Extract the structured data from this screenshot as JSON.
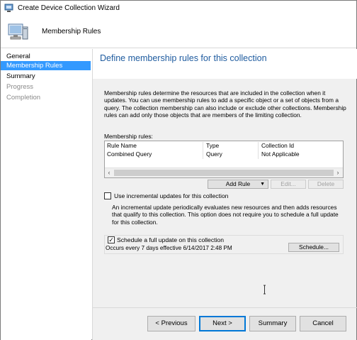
{
  "window": {
    "title": "Create Device Collection Wizard"
  },
  "header": {
    "title": "Membership Rules"
  },
  "sidebar": {
    "items": [
      {
        "label": "General",
        "state": "normal"
      },
      {
        "label": "Membership Rules",
        "state": "active"
      },
      {
        "label": "Summary",
        "state": "normal"
      },
      {
        "label": "Progress",
        "state": "disabled"
      },
      {
        "label": "Completion",
        "state": "disabled"
      }
    ]
  },
  "main": {
    "section_title": "Define membership rules for this collection",
    "description": "Membership rules determine the resources that are included in the collection when it updates. You can use membership rules to add a specific object or a set of objects from a query. The collection membership can also include or exclude other collections. Membership rules can add only those objects that are members of the limiting collection.",
    "rules_label": "Membership rules:",
    "rules_table": {
      "columns": [
        "Rule Name",
        "Type",
        "Collection Id"
      ],
      "rows": [
        [
          "Combined Query",
          "Query",
          "Not Applicable"
        ]
      ]
    },
    "add_rule_label": "Add Rule",
    "edit_label": "Edit...",
    "delete_label": "Delete",
    "incremental": {
      "checked": false,
      "label": "Use incremental updates for this collection",
      "description": "An incremental update periodically evaluates new resources and then adds resources that qualify to this collection. This option does not require you to schedule a full update for this collection."
    },
    "schedule": {
      "checked": true,
      "label": "Schedule a full update on this collection",
      "summary": "Occurs every 7 days effective 6/14/2017 2:48 PM",
      "button_label": "Schedule..."
    }
  },
  "footer": {
    "previous_label": "< Previous",
    "next_label": "Next >",
    "summary_label": "Summary",
    "cancel_label": "Cancel"
  },
  "colors": {
    "accent": "#3399ff",
    "title_blue": "#1e5b9f",
    "panel": "#f0f0f0"
  },
  "icons": [
    "wizard-app-icon",
    "computer-icon",
    "chevron-down-icon",
    "scroll-left-icon",
    "scroll-right-icon",
    "mouse-cursor-icon"
  ]
}
